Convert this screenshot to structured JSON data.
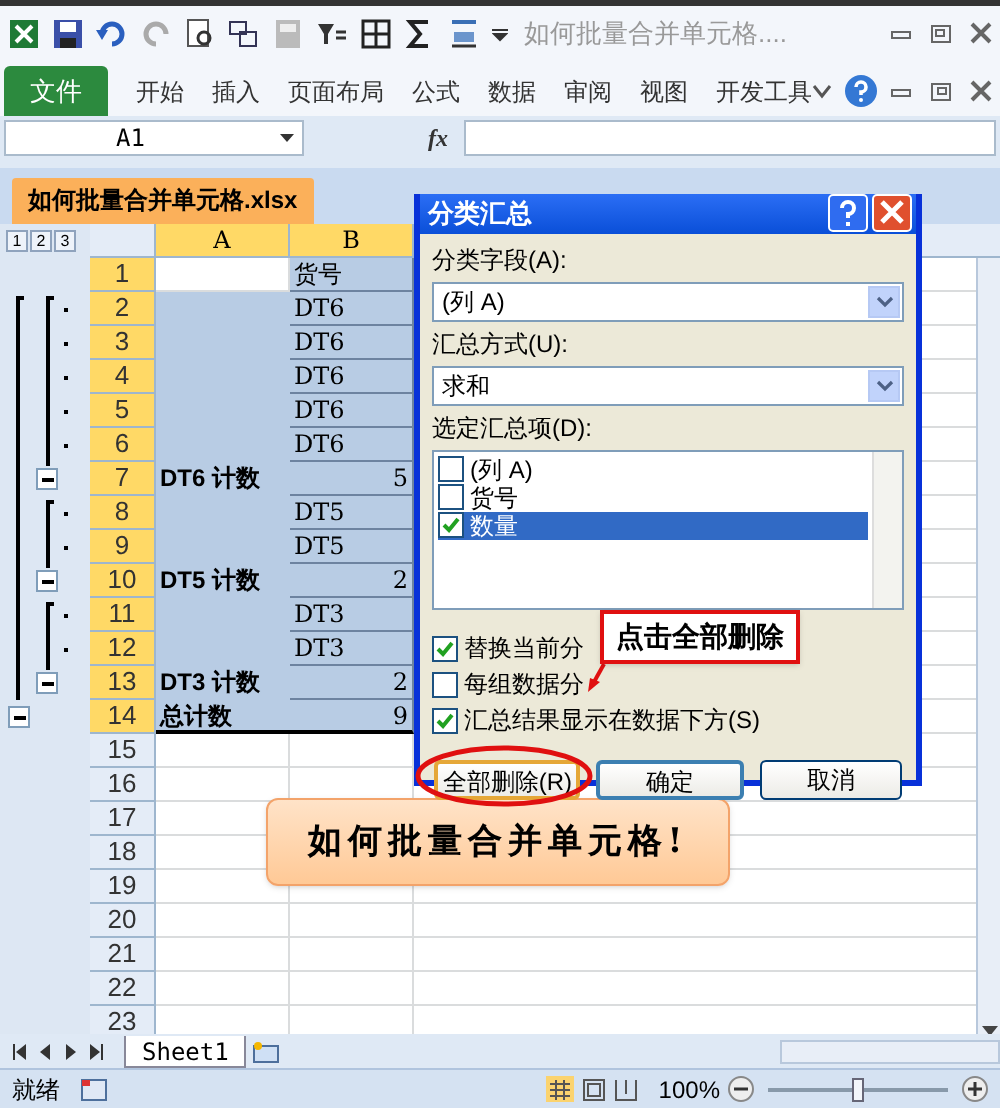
{
  "window": {
    "title": "如何批量合并单元格...."
  },
  "ribbon_tabs": [
    {
      "label": "文件",
      "kind": "file"
    },
    {
      "label": "开始",
      "kind": "tab"
    },
    {
      "label": "插入",
      "kind": "tab"
    },
    {
      "label": "页面布局",
      "kind": "tab"
    },
    {
      "label": "公式",
      "kind": "tab"
    },
    {
      "label": "数据",
      "kind": "tab"
    },
    {
      "label": "审阅",
      "kind": "tab"
    },
    {
      "label": "视图",
      "kind": "tab"
    },
    {
      "label": "开发工具",
      "kind": "tab"
    }
  ],
  "name_box": "A1",
  "formula_icon": "fx",
  "workbook_tab": "如何批量合并单元格.xlsx",
  "outline_levels": [
    "1",
    "2",
    "3"
  ],
  "columns": [
    "A",
    "B"
  ],
  "rows": [
    {
      "num": "1",
      "kind": "header",
      "b": "货号"
    },
    {
      "num": "2",
      "kind": "detail",
      "b": "DT6"
    },
    {
      "num": "3",
      "kind": "detail",
      "b": "DT6"
    },
    {
      "num": "4",
      "kind": "detail",
      "b": "DT6"
    },
    {
      "num": "5",
      "kind": "detail",
      "b": "DT6"
    },
    {
      "num": "6",
      "kind": "detail",
      "b": "DT6"
    },
    {
      "num": "7",
      "kind": "subtotal",
      "a": "DT6 计数",
      "b": "5"
    },
    {
      "num": "8",
      "kind": "detail",
      "b": "DT5"
    },
    {
      "num": "9",
      "kind": "detail",
      "b": "DT5"
    },
    {
      "num": "10",
      "kind": "subtotal",
      "a": "DT5 计数",
      "b": "2"
    },
    {
      "num": "11",
      "kind": "detail",
      "b": "DT3"
    },
    {
      "num": "12",
      "kind": "detail",
      "b": "DT3"
    },
    {
      "num": "13",
      "kind": "subtotal",
      "a": "DT3 计数",
      "b": "2"
    },
    {
      "num": "14",
      "kind": "total",
      "a": "总计数",
      "b": "9"
    },
    {
      "num": "15",
      "kind": "empty"
    },
    {
      "num": "16",
      "kind": "empty"
    },
    {
      "num": "17",
      "kind": "empty"
    },
    {
      "num": "18",
      "kind": "empty"
    },
    {
      "num": "19",
      "kind": "empty"
    },
    {
      "num": "20",
      "kind": "empty"
    },
    {
      "num": "21",
      "kind": "empty"
    },
    {
      "num": "22",
      "kind": "empty"
    },
    {
      "num": "23",
      "kind": "empty"
    }
  ],
  "shape_text": "如何批量合并单元格!",
  "dialog": {
    "title": "分类汇总",
    "field_label": "分类字段(A):",
    "field_value": "(列 A)",
    "method_label": "汇总方式(U):",
    "method_value": "求和",
    "items_label": "选定汇总项(D):",
    "items": [
      {
        "label": "(列 A)",
        "checked": false,
        "selected": false
      },
      {
        "label": "货号",
        "checked": false,
        "selected": false
      },
      {
        "label": "数量",
        "checked": true,
        "selected": true
      }
    ],
    "options": [
      {
        "label": "替换当前分",
        "checked": true
      },
      {
        "label": "每组数据分",
        "checked": false
      },
      {
        "label": "汇总结果显示在数据下方(S)",
        "checked": true
      }
    ],
    "buttons": [
      {
        "label": "全部删除(R)",
        "kind": "highlighted"
      },
      {
        "label": "确定",
        "kind": "default"
      },
      {
        "label": "取消",
        "kind": "normal"
      }
    ]
  },
  "annotation": "点击全部删除",
  "sheet_tab": "Sheet1",
  "status": "就绪",
  "zoom": "100%",
  "zoom_slider": {
    "level": 0.5
  }
}
